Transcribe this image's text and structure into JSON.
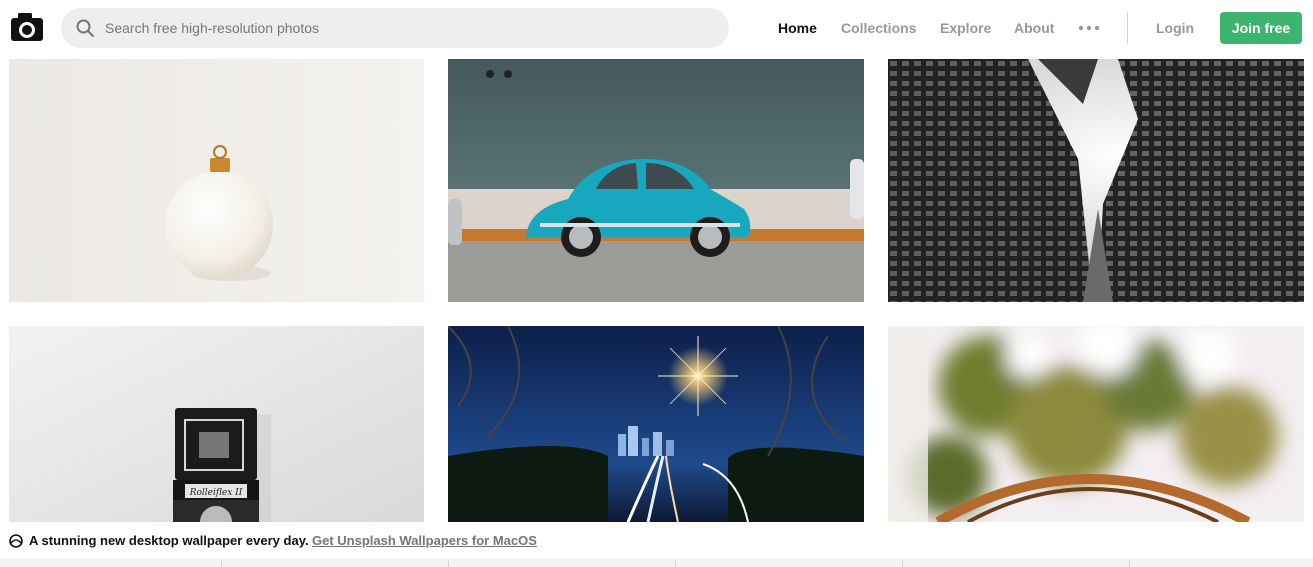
{
  "header": {
    "logo_icon": "camera-icon",
    "search": {
      "icon": "search-icon",
      "placeholder": "Search free high-resolution photos",
      "value": ""
    },
    "nav": [
      {
        "label": "Home",
        "active": true
      },
      {
        "label": "Collections",
        "active": false
      },
      {
        "label": "Explore",
        "active": false
      },
      {
        "label": "About",
        "active": false
      }
    ],
    "more_icon": "more-horizontal-icon",
    "login_label": "Login",
    "join_label": "Join free",
    "accent_color": "#3cb46e"
  },
  "photos": [
    {
      "subject": "white-ornament-bauble"
    },
    {
      "subject": "turquoise-volkswagen-beetle"
    },
    {
      "subject": "skyscrapers-looking-up"
    },
    {
      "subject": "vintage-twin-lens-camera"
    },
    {
      "subject": "city-highway-night-through-fence"
    },
    {
      "subject": "basketball-hoop-blurred-tree"
    }
  ],
  "banner": {
    "icon": "wallpaper-icon",
    "text": "A stunning new desktop wallpaper every day.",
    "link_label": "Get Unsplash Wallpapers for MacOS"
  },
  "camera_label": "Rolleiflex II"
}
